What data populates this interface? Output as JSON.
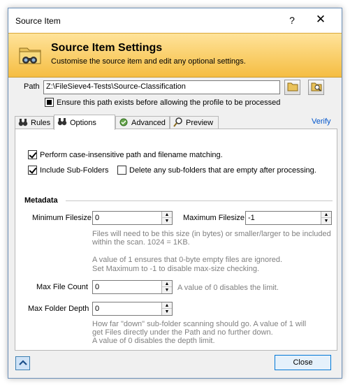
{
  "window": {
    "title": "Source Item",
    "help_glyph": "?",
    "close_glyph": "✕"
  },
  "header": {
    "title": "Source Item Settings",
    "subtitle": "Customise the source item and edit any optional settings."
  },
  "path": {
    "label": "Path",
    "value": "Z:\\FileSieve4-Tests\\Source-Classification",
    "ensure_label": "Ensure this path exists before allowing the profile to be processed",
    "ensure_checked": true
  },
  "tabs": [
    {
      "label": "Rules",
      "icon": "binoculars-icon",
      "active": false
    },
    {
      "label": "Options",
      "icon": "binoculars-icon",
      "active": true
    },
    {
      "label": "Advanced",
      "icon": "gear-check-icon",
      "active": false
    },
    {
      "label": "Preview",
      "icon": "magnifier-icon",
      "active": false
    }
  ],
  "verify_link": "Verify",
  "options": {
    "case_insensitive": {
      "label": "Perform case-insensitive path and filename matching.",
      "checked": true
    },
    "include_subfolders": {
      "label": "Include Sub-Folders",
      "checked": true
    },
    "delete_empty": {
      "label": "Delete any sub-folders that are empty after processing.",
      "checked": false
    }
  },
  "metadata": {
    "heading": "Metadata",
    "min_filesize": {
      "label": "Minimum Filesize",
      "value": "0"
    },
    "max_filesize": {
      "label": "Maximum Filesize",
      "value": "-1"
    },
    "filesize_hint_1": "Files will need to be this size (in bytes) or smaller/larger to be included",
    "filesize_hint_2": "within the scan. 1024 = 1KB.",
    "filesize_hint_3": "A value of 1 ensures that 0-byte empty files are ignored.",
    "filesize_hint_4": "Set Maximum to -1 to disable max-size checking.",
    "max_file_count": {
      "label": "Max File Count",
      "value": "0",
      "hint": "A value of 0 disables the limit."
    },
    "max_folder_depth": {
      "label": "Max Folder Depth",
      "value": "0"
    },
    "depth_hint_1": "How far \"down\" sub-folder scanning should go. A value of 1 will",
    "depth_hint_2": "get Files directly under the Path and no further down.",
    "depth_hint_3": "A value of 0 disables the depth limit."
  },
  "footer": {
    "close_label": "Close"
  },
  "colors": {
    "header_top": "#ffe39a",
    "header_bottom": "#f5bd42",
    "link": "#0055cc",
    "accent": "#0078d7"
  }
}
